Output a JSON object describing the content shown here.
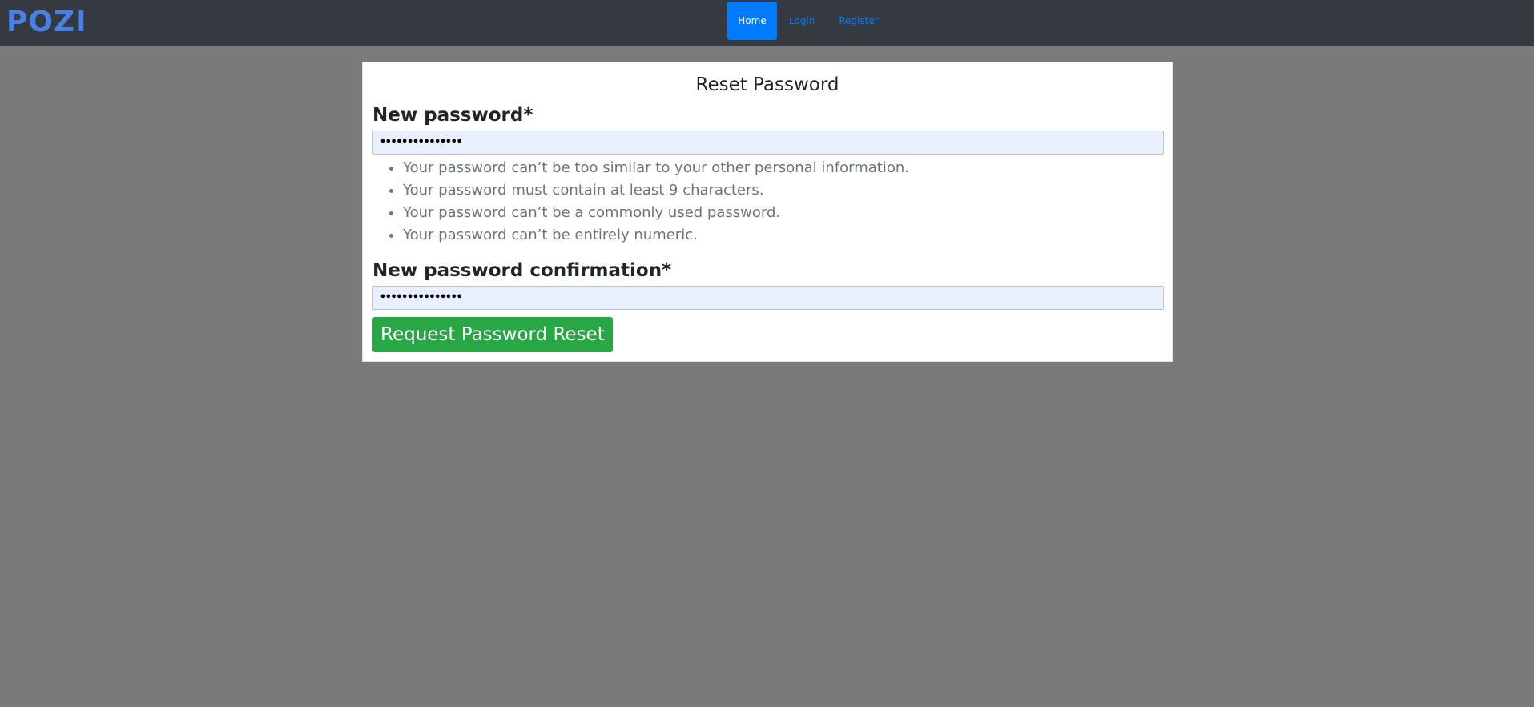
{
  "navbar": {
    "logo_text": "POZI",
    "links": [
      {
        "label": "Home",
        "active": true
      },
      {
        "label": "Login",
        "active": false
      },
      {
        "label": "Register",
        "active": false
      }
    ]
  },
  "form": {
    "title": "Reset Password",
    "new_password": {
      "label": "New password*",
      "value": "•••••••••••••••"
    },
    "help_text": [
      "Your password can’t be too similar to your other personal information.",
      "Your password must contain at least 9 characters.",
      "Your password can’t be a commonly used password.",
      "Your password can’t be entirely numeric."
    ],
    "confirm_password": {
      "label": "New password confirmation*",
      "value": "•••••••••••••••"
    },
    "submit_label": "Request Password Reset"
  },
  "colors": {
    "navbar_bg": "#343a40",
    "page_bg": "#7a7a7a",
    "logo": "#4a7fe6",
    "link": "#007bff",
    "active_link_bg": "#007bff",
    "submit_bg": "#28a745",
    "input_bg": "#e8f0fe",
    "help_text": "#6c757d"
  }
}
